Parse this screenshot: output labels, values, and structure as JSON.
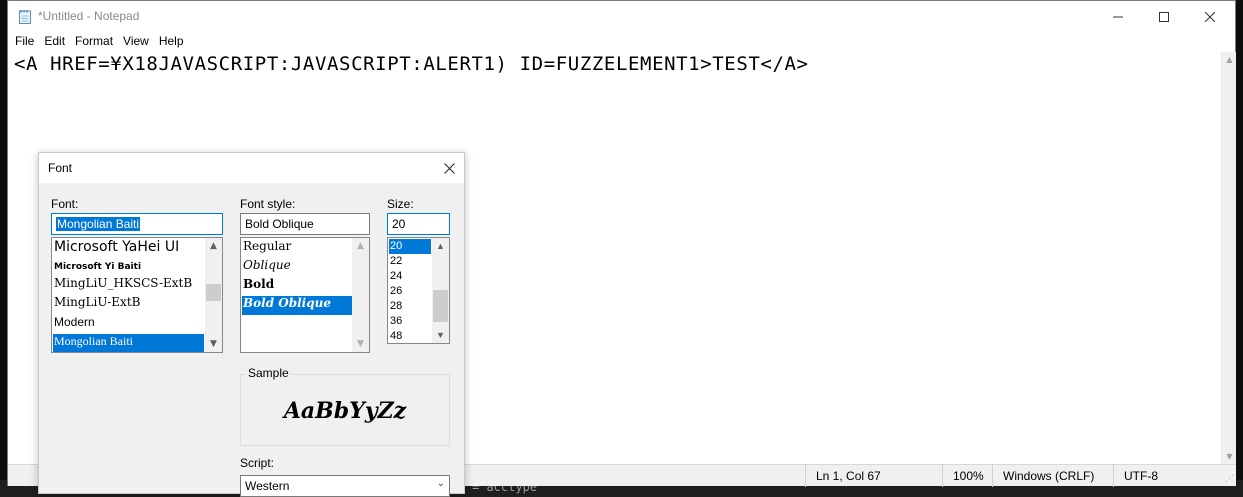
{
  "window": {
    "title": "*Untitled - Notepad"
  },
  "menu": [
    "File",
    "Edit",
    "Format",
    "View",
    "Help"
  ],
  "editor": {
    "content": "<A HREF=¥X18JAVASCRIPT:JAVASCRIPT:ALERT1) ID=FUZZELEMENT1>TEST</A>"
  },
  "statusbar": {
    "position": "Ln 1, Col 67",
    "zoom": "100%",
    "line_ending": "Windows (CRLF)",
    "encoding": "UTF-8"
  },
  "background": {
    "terminal_text": "= acctype"
  },
  "font_dialog": {
    "title": "Font",
    "font_label": "Font:",
    "font_value": "Mongolian Baiti",
    "font_list": [
      "Microsoft YaHei UI",
      "Microsoft Yi Baiti",
      "MingLiU_HKSCS-ExtB",
      "MingLiU-ExtB",
      "Modern",
      "Mongolian Baiti"
    ],
    "font_selected": "Mongolian Baiti",
    "style_label": "Font style:",
    "style_value": "Bold Oblique",
    "style_list": [
      "Regular",
      "Oblique",
      "Bold",
      "Bold Oblique"
    ],
    "style_selected": "Bold Oblique",
    "size_label": "Size:",
    "size_value": "20",
    "size_list": [
      "20",
      "22",
      "24",
      "26",
      "28",
      "36",
      "48"
    ],
    "size_selected": "20",
    "sample_label": "Sample",
    "sample_text": "AaBbYyZz",
    "script_label": "Script:",
    "script_value": "Western"
  },
  "colors": {
    "selection": "#0078d7",
    "dialog_bg": "#f0f0f0",
    "window_bg": "#ffffff"
  }
}
